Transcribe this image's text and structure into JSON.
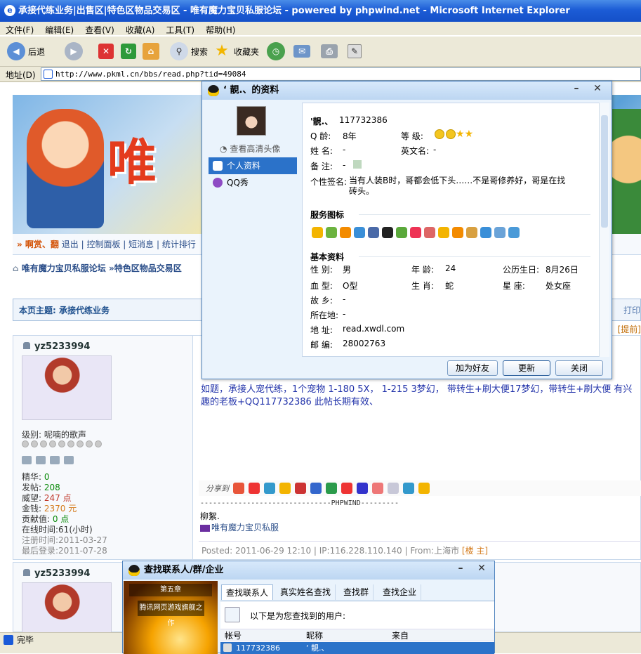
{
  "window": {
    "title": "承接代练业务|出售区|特色区物品交易区 - 唯有魔力宝贝私服论坛 - powered by phpwind.net - Microsoft Internet Explorer"
  },
  "menu": [
    "文件(F)",
    "编辑(E)",
    "查看(V)",
    "收藏(A)",
    "工具(T)",
    "帮助(H)"
  ],
  "toolbar": {
    "back": "后退",
    "search": "搜索",
    "favorites": "收藏夹"
  },
  "address": {
    "label": "地址(D)",
    "url": "http://www.pkml.cn/bbs/read.php?tid=49084"
  },
  "nav": {
    "user": "» 啊赏、翻",
    "items": [
      "退出",
      "控制面板",
      "短消息",
      "统计排行"
    ]
  },
  "breadcrumb": "唯有魔力宝贝私服论坛 »特色区物品交易区",
  "topic": {
    "title": "本页主题: 承接代练业务",
    "print": "打印",
    "quick": "[提前]"
  },
  "post": {
    "user": "yz5233994",
    "level": "级别: 呢喃的歌声",
    "stats": [
      {
        "k": "精华: ",
        "v": "0",
        "c": "green"
      },
      {
        "k": "发帖: ",
        "v": "208",
        "c": "green"
      },
      {
        "k": "威望: ",
        "v": "247 点",
        "c": "red"
      },
      {
        "k": "金钱: ",
        "v": "2370 元",
        "c": "orange"
      },
      {
        "k": "贡献值: ",
        "v": "0 点",
        "c": "green"
      },
      {
        "k": "在线时间:",
        "v": "61(小时)",
        "c": ""
      },
      {
        "k": "注册时间:",
        "v": "2011-03-27",
        "c": "gray"
      },
      {
        "k": "最后登录:",
        "v": "2011-07-28",
        "c": "gray"
      }
    ],
    "body": "如题，承接人宠代练，1个宠物  1-180  5X，  1-215  3梦幻，  带转生+刷大便17梦幻，带转生+刷大便 有兴趣的老板+QQ117732386 此帖长期有效、",
    "share": "分享到",
    "sigline": "-------------------------------PHPWIND---------",
    "sig1": "柳絮.",
    "sig2": "唯有魔力宝贝私服",
    "footer_pre": "Posted: 2011-06-29 12:10 | IP:116.228.110.140 | From:上海市 ",
    "footer_tag": "[楼 主]"
  },
  "post2": {
    "user": "yz5233994"
  },
  "status": "完毕",
  "profile": {
    "title": "‘ 靚.、的资料",
    "hd_link": "查看高清头像",
    "nav": [
      "个人资料",
      "QQ秀"
    ],
    "nick": "'靚.、",
    "qq": "117732386",
    "age_label": "Q   龄:",
    "age": "8年",
    "grade_label": "等   级:",
    "name_label": "姓   名:",
    "name": "-",
    "en_label": "英文名:",
    "en": "-",
    "note_label": "备   注:",
    "note": "-",
    "sig_label": "个性签名:",
    "sig": "当有人装B时，哥都会低下头……不是哥修养好，哥是在找 砖头。",
    "svc_title": "服务图标",
    "basic_title": "基本资料",
    "fields": [
      {
        "l": "性   别:",
        "v": "男"
      },
      {
        "l": "年   龄:",
        "v": "24"
      },
      {
        "l": "公历生日:",
        "v": "8月26日"
      },
      {
        "l": "血   型:",
        "v": "O型"
      },
      {
        "l": "生   肖:",
        "v": "蛇"
      },
      {
        "l": "星     座:",
        "v": "处女座"
      },
      {
        "l": "故   乡:",
        "v": "-"
      },
      {
        "l": "所在地:",
        "v": "-"
      },
      {
        "l": "地   址:",
        "v": "read.xwdl.com"
      },
      {
        "l": "邮   编:",
        "v": "28002763"
      }
    ],
    "btn_add": "加为好友",
    "btn_refresh": "更新",
    "btn_close": "关闭"
  },
  "find": {
    "title": "查找联系人/群/企业",
    "banner": "第五章",
    "banner_sub": "腾讯网页游戏旗舰之作",
    "tabs": [
      "查找联系人",
      "真实姓名查找",
      "查找群",
      "查找企业"
    ],
    "msg": "以下是为您查找到的用户:",
    "cols": [
      "帐号",
      "昵称",
      "来自"
    ],
    "row": {
      "id": "117732386",
      "nick": "‘ 靚.、"
    }
  }
}
